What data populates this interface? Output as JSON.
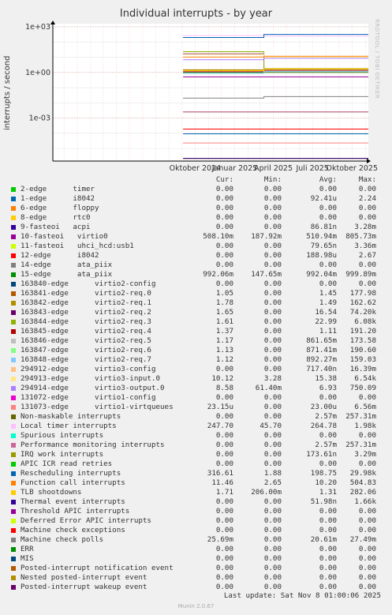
{
  "title": "Individual interrupts - by year",
  "watermark": "RRDTOOL / TOBI OETIKER",
  "footer": "Last update: Sat Nov  8 01:00:06 2025",
  "munin_version": "Munin 2.0.67",
  "table_headers": {
    "cur": "Cur:",
    "min": "Min:",
    "avg": "Avg:",
    "max": "Max:"
  },
  "chart_data": {
    "type": "line",
    "title": "Individual interrupts - by year",
    "ylabel": "interrupts / second",
    "yscale": "log",
    "ylim": [
      1.5e-06,
      1600
    ],
    "y_ticks": [
      {
        "value": 1000,
        "label": "1e+03"
      },
      {
        "value": 1,
        "label": "1e+00"
      },
      {
        "value": 0.001,
        "label": "1e-03"
      }
    ],
    "x_range": [
      "2023-11-05",
      "2025-11-08"
    ],
    "x_ticks": [
      {
        "date": "2024-10-01",
        "label": "Oktober 2024"
      },
      {
        "date": "2025-01-01",
        "label": "Januar 2025"
      },
      {
        "date": "2025-04-01",
        "label": "April 2025"
      },
      {
        "date": "2025-07-01",
        "label": "Juli 2025"
      },
      {
        "date": "2025-10-01",
        "label": "Oktober 2025"
      }
    ],
    "grid": true,
    "legend_position": "below",
    "series": [
      {
        "name": "2-edge      timer",
        "color": "#00cc00",
        "cur": "0.00",
        "min": "0.00",
        "avg": "0.00",
        "max": "0.00"
      },
      {
        "name": "1-edge      i8042",
        "color": "#0066b3",
        "cur": "0.00",
        "min": "0.00",
        "avg": "92.41u",
        "max": "2.24"
      },
      {
        "name": "6-edge      floppy",
        "color": "#ff8000",
        "cur": "0.00",
        "min": "0.00",
        "avg": "0.00",
        "max": "0.00"
      },
      {
        "name": "8-edge      rtc0",
        "color": "#ffcc00",
        "cur": "0.00",
        "min": "0.00",
        "avg": "0.00",
        "max": "0.00"
      },
      {
        "name": "9-fasteoi   acpi",
        "color": "#330099",
        "cur": "0.00",
        "min": "0.00",
        "avg": "86.81n",
        "max": "3.28m"
      },
      {
        "name": "10-fasteoi   virtio0",
        "color": "#990099",
        "cur": "508.10m",
        "min": "187.92m",
        "avg": "510.94m",
        "max": "805.73m"
      },
      {
        "name": "11-fasteoi   uhci_hcd:usb1",
        "color": "#ccff00",
        "cur": "0.00",
        "min": "0.00",
        "avg": "79.65n",
        "max": "3.36m"
      },
      {
        "name": "12-edge      i8042",
        "color": "#ff0000",
        "cur": "0.00",
        "min": "0.00",
        "avg": "188.98u",
        "max": "2.67"
      },
      {
        "name": "14-edge      ata_piix",
        "color": "#808080",
        "cur": "0.00",
        "min": "0.00",
        "avg": "0.00",
        "max": "0.00"
      },
      {
        "name": "15-edge      ata_piix",
        "color": "#008f00",
        "cur": "992.06m",
        "min": "147.65m",
        "avg": "992.04m",
        "max": "999.89m"
      },
      {
        "name": "163840-edge      virtio2-config",
        "color": "#00487d",
        "cur": "0.00",
        "min": "0.00",
        "avg": "0.00",
        "max": "0.00"
      },
      {
        "name": "163841-edge      virtio2-req.0",
        "color": "#b35a00",
        "cur": "1.05",
        "min": "0.00",
        "avg": "1.45",
        "max": "177.98"
      },
      {
        "name": "163842-edge      virtio2-req.1",
        "color": "#b38f00",
        "cur": "1.78",
        "min": "0.00",
        "avg": "1.49",
        "max": "162.62"
      },
      {
        "name": "163843-edge      virtio2-req.2",
        "color": "#6b006b",
        "cur": "1.65",
        "min": "0.00",
        "avg": "16.54",
        "max": "74.20k"
      },
      {
        "name": "163844-edge      virtio2-req.3",
        "color": "#8fb300",
        "cur": "1.61",
        "min": "0.00",
        "avg": "22.99",
        "max": "6.08k"
      },
      {
        "name": "163845-edge      virtio2-req.4",
        "color": "#b30000",
        "cur": "1.37",
        "min": "0.00",
        "avg": "1.11",
        "max": "191.20"
      },
      {
        "name": "163846-edge      virtio2-req.5",
        "color": "#bebebe",
        "cur": "1.17",
        "min": "0.00",
        "avg": "861.65m",
        "max": "173.58"
      },
      {
        "name": "163847-edge      virtio2-req.6",
        "color": "#80ff80",
        "cur": "1.13",
        "min": "0.00",
        "avg": "871.41m",
        "max": "190.60"
      },
      {
        "name": "163848-edge      virtio2-req.7",
        "color": "#80c9ff",
        "cur": "1.12",
        "min": "0.00",
        "avg": "892.27m",
        "max": "159.03"
      },
      {
        "name": "294912-edge      virtio3-config",
        "color": "#ffc080",
        "cur": "0.00",
        "min": "0.00",
        "avg": "717.40n",
        "max": "16.39m"
      },
      {
        "name": "294913-edge      virtio3-input.0",
        "color": "#ffe680",
        "cur": "10.12",
        "min": "3.28",
        "avg": "15.38",
        "max": "6.54k"
      },
      {
        "name": "294914-edge      virtio3-output.0",
        "color": "#aa80ff",
        "cur": "8.58",
        "min": "61.40m",
        "avg": "6.93",
        "max": "750.09"
      },
      {
        "name": "131072-edge      virtio1-config",
        "color": "#ee00cc",
        "cur": "0.00",
        "min": "0.00",
        "avg": "0.00",
        "max": "0.00"
      },
      {
        "name": "131073-edge      virtio1-virtqueues",
        "color": "#ff8080",
        "cur": "23.15u",
        "min": "0.00",
        "avg": "23.00u",
        "max": "6.56m"
      },
      {
        "name": "Non-maskable interrupts",
        "color": "#666600",
        "cur": "0.00",
        "min": "0.00",
        "avg": "2.57m",
        "max": "257.31m"
      },
      {
        "name": "Local timer interrupts",
        "color": "#ffbfff",
        "cur": "247.70",
        "min": "45.70",
        "avg": "264.78",
        "max": "1.98k"
      },
      {
        "name": "Spurious interrupts",
        "color": "#00ffcc",
        "cur": "0.00",
        "min": "0.00",
        "avg": "0.00",
        "max": "0.00"
      },
      {
        "name": "Performance monitoring interrupts",
        "color": "#cc6699",
        "cur": "0.00",
        "min": "0.00",
        "avg": "2.57m",
        "max": "257.31m"
      },
      {
        "name": "IRQ work interrupts",
        "color": "#999900",
        "cur": "0.00",
        "min": "0.00",
        "avg": "173.61n",
        "max": "3.29m"
      },
      {
        "name": "APIC ICR read retries",
        "color": "#00cc00",
        "cur": "0.00",
        "min": "0.00",
        "avg": "0.00",
        "max": "0.00"
      },
      {
        "name": "Rescheduling interrupts",
        "color": "#0066b3",
        "cur": "316.61",
        "min": "1.88",
        "avg": "198.75",
        "max": "29.98k"
      },
      {
        "name": "Function call interrupts",
        "color": "#ff8000",
        "cur": "11.46",
        "min": "2.65",
        "avg": "10.20",
        "max": "504.83"
      },
      {
        "name": "TLB shootdowns",
        "color": "#ffcc00",
        "cur": "1.71",
        "min": "206.00m",
        "avg": "1.31",
        "max": "282.06"
      },
      {
        "name": "Thermal event interrupts",
        "color": "#330099",
        "cur": "0.00",
        "min": "0.00",
        "avg": "51.98n",
        "max": "1.66k"
      },
      {
        "name": "Threshold APIC interrupts",
        "color": "#990099",
        "cur": "0.00",
        "min": "0.00",
        "avg": "0.00",
        "max": "0.00"
      },
      {
        "name": "Deferred Error APIC interrupts",
        "color": "#ccff00",
        "cur": "0.00",
        "min": "0.00",
        "avg": "0.00",
        "max": "0.00"
      },
      {
        "name": "Machine check exceptions",
        "color": "#ff0000",
        "cur": "0.00",
        "min": "0.00",
        "avg": "0.00",
        "max": "0.00"
      },
      {
        "name": "Machine check polls",
        "color": "#808080",
        "cur": "25.69m",
        "min": "0.00",
        "avg": "20.61m",
        "max": "27.49m"
      },
      {
        "name": "ERR",
        "color": "#008f00",
        "cur": "0.00",
        "min": "0.00",
        "avg": "0.00",
        "max": "0.00"
      },
      {
        "name": "MIS",
        "color": "#00487d",
        "cur": "0.00",
        "min": "0.00",
        "avg": "0.00",
        "max": "0.00"
      },
      {
        "name": "Posted-interrupt notification event",
        "color": "#b35a00",
        "cur": "0.00",
        "min": "0.00",
        "avg": "0.00",
        "max": "0.00"
      },
      {
        "name": "Nested posted-interrupt event",
        "color": "#b38f00",
        "cur": "0.00",
        "min": "0.00",
        "avg": "0.00",
        "max": "0.00"
      },
      {
        "name": "Posted-interrupt wakeup event",
        "color": "#6b006b",
        "cur": "0.00",
        "min": "0.00",
        "avg": "0.00",
        "max": "0.00"
      }
    ]
  }
}
